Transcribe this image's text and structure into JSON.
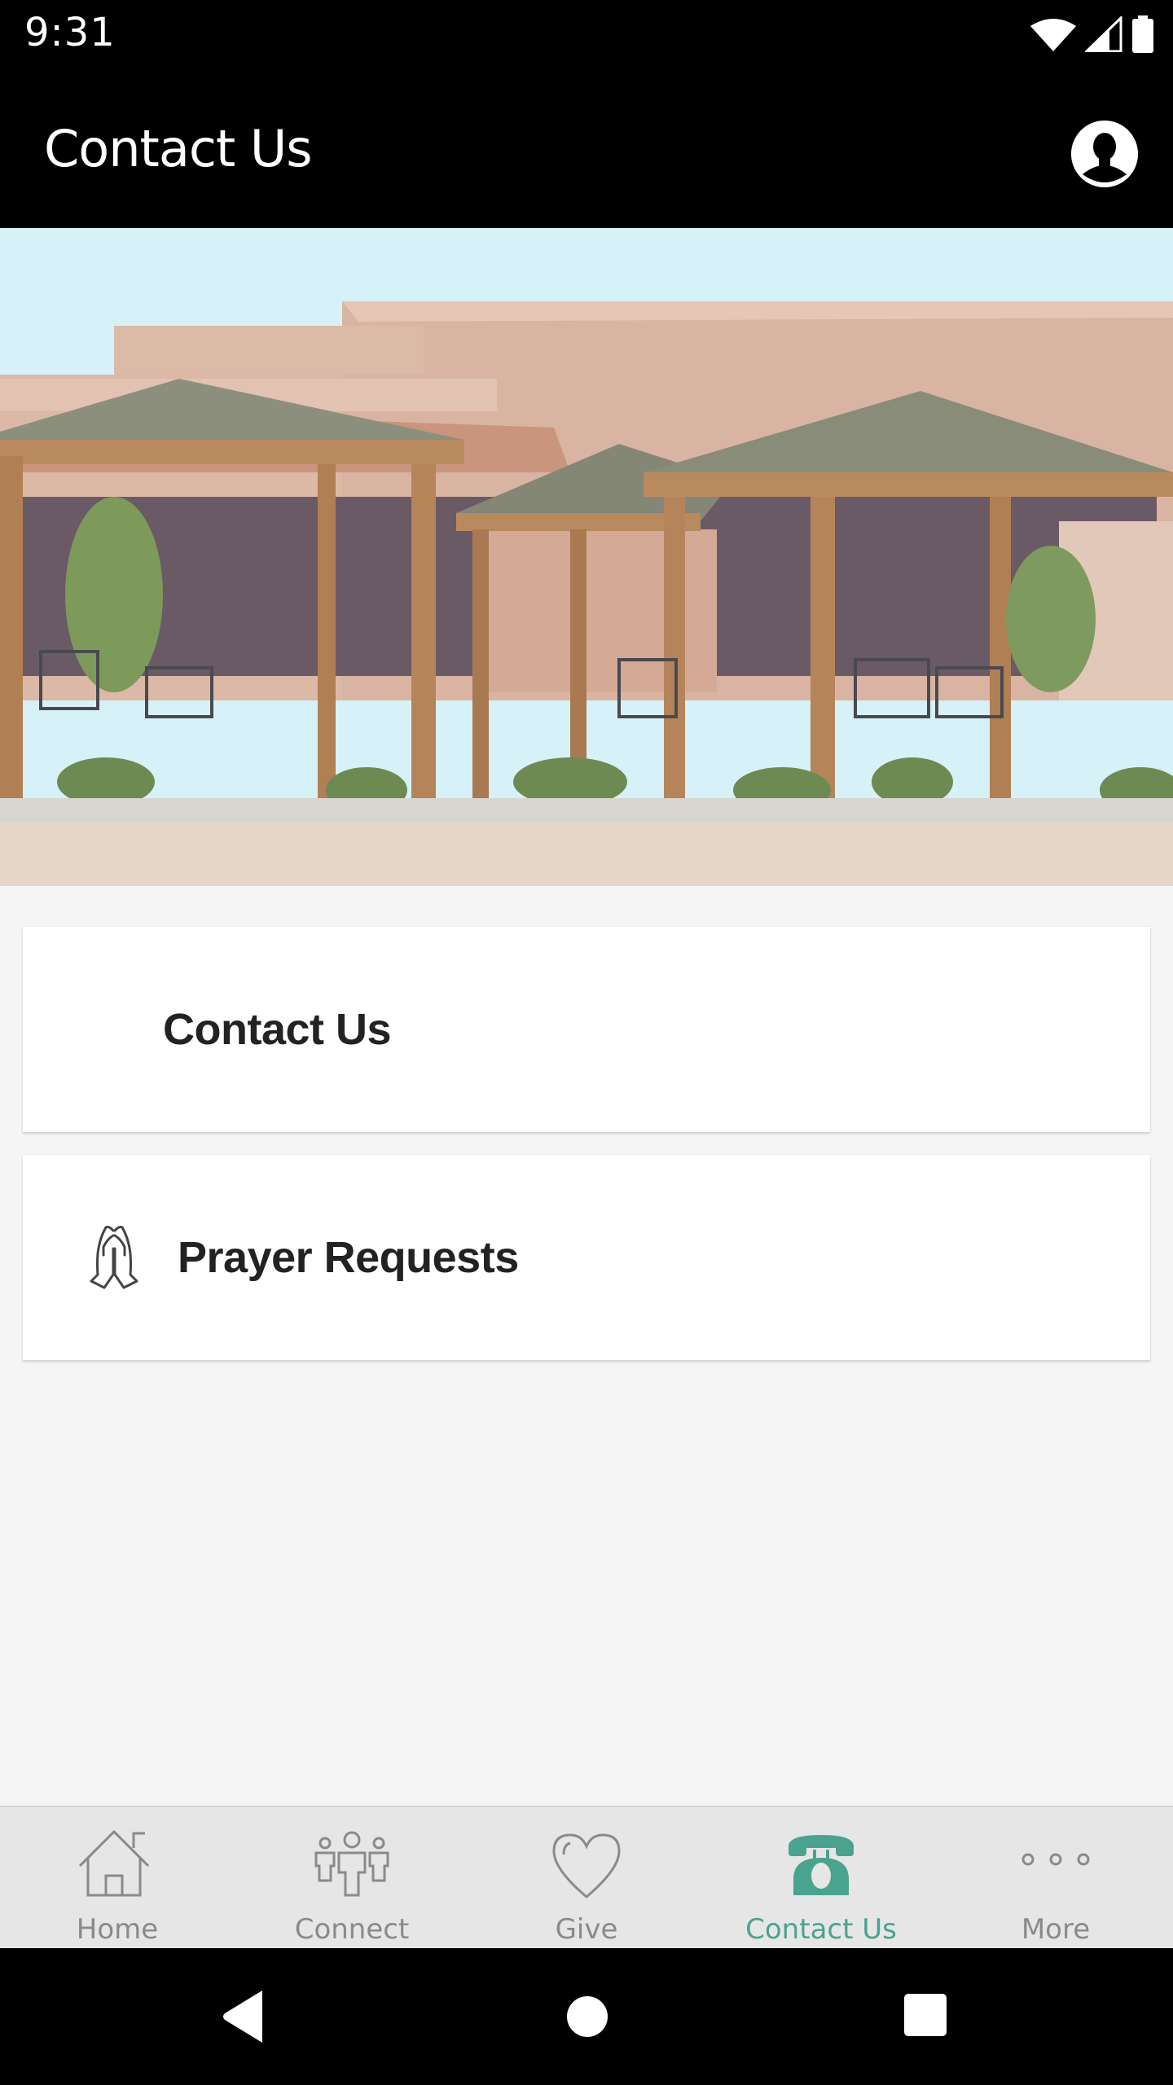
{
  "status_bar": {
    "time": "9:31",
    "icons": [
      "wifi-icon",
      "cell-signal-icon",
      "battery-icon"
    ]
  },
  "app_bar": {
    "title": "Contact Us",
    "profile_icon": "account-circle-icon"
  },
  "hero": {
    "description": "Photo of church building patio with wooden gazebos and outdoor seating"
  },
  "cards": [
    {
      "label": "Contact Us",
      "icon": ""
    },
    {
      "label": "Prayer Requests",
      "icon": "praying-hands-icon"
    }
  ],
  "bottom_nav": {
    "accent_color": "#4aa38f",
    "inactive_color": "#8a8a8a",
    "items": [
      {
        "label": "Home",
        "icon": "home-icon",
        "active": false
      },
      {
        "label": "Connect",
        "icon": "people-icon",
        "active": false
      },
      {
        "label": "Give",
        "icon": "heart-icon",
        "active": false
      },
      {
        "label": "Contact Us",
        "icon": "telephone-icon",
        "active": true
      },
      {
        "label": "More",
        "icon": "more-dots-icon",
        "active": false
      }
    ]
  },
  "system_nav": {
    "buttons": [
      "back",
      "home",
      "recents"
    ]
  }
}
